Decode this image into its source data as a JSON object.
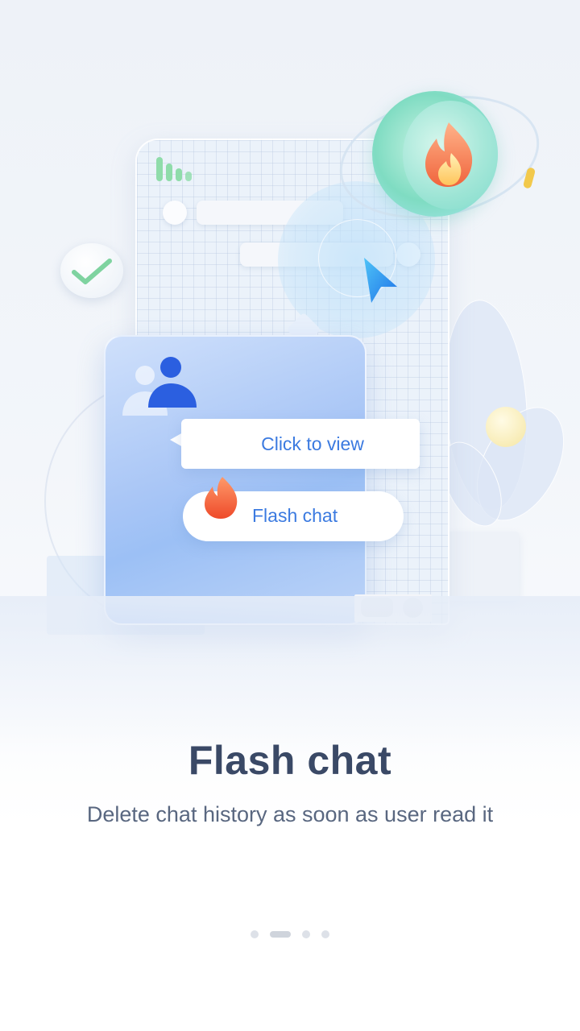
{
  "illustration": {
    "bubble_label": "Click to view",
    "pill_label": "Flash chat"
  },
  "onboarding": {
    "title": "Flash chat",
    "subtitle": "Delete chat history as soon as user read it"
  },
  "pager": {
    "total": 4,
    "active_index": 1
  },
  "colors": {
    "accent": "#3b7ae0",
    "title": "#3a4966",
    "subtitle": "#596780"
  }
}
